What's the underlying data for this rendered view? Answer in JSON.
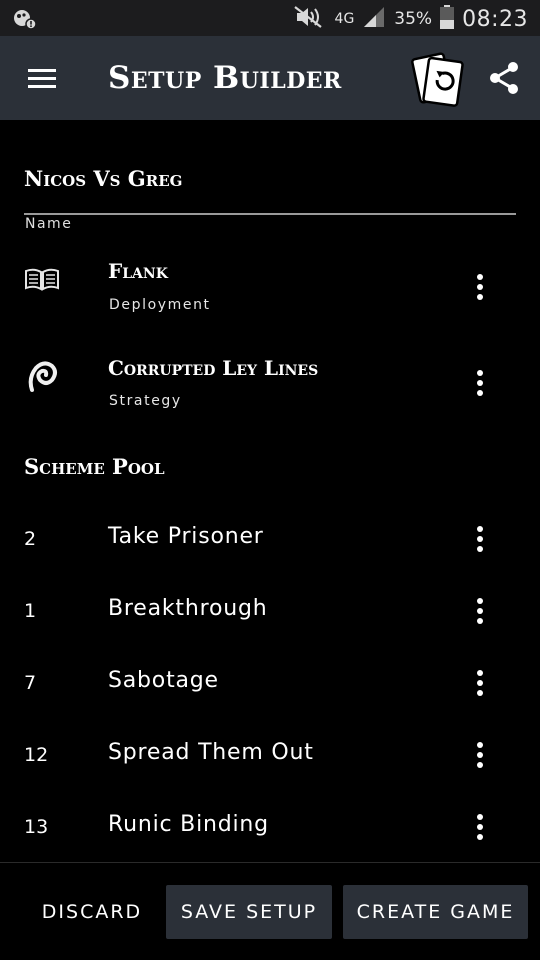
{
  "status_bar": {
    "network": "4G",
    "battery": "35%",
    "time": "08:23",
    "icons": [
      "notification-icon",
      "mute-icon",
      "signal-icon",
      "battery-icon"
    ]
  },
  "app_bar": {
    "title": "Setup Builder",
    "icons": [
      "menu-icon",
      "cards-undo-icon",
      "share-icon"
    ]
  },
  "setup": {
    "header": "Nicos Vs Greg",
    "name_label": "Name",
    "items": [
      {
        "title": "Flank",
        "subtitle": "Deployment",
        "icon": "book-icon"
      },
      {
        "title": "Corrupted Ley Lines",
        "subtitle": "Strategy",
        "icon": "swirl-icon"
      }
    ]
  },
  "scheme_pool": {
    "header": "Scheme Pool",
    "items": [
      {
        "number": "2",
        "name": "Take Prisoner"
      },
      {
        "number": "1",
        "name": "Breakthrough"
      },
      {
        "number": "7",
        "name": "Sabotage"
      },
      {
        "number": "12",
        "name": "Spread Them Out"
      },
      {
        "number": "13",
        "name": "Runic Binding"
      }
    ]
  },
  "actions": {
    "discard": "Discard",
    "save_setup": "Save Setup",
    "create_game": "Create Game"
  },
  "colors": {
    "background": "#000000",
    "app_bar": "#2b3038",
    "status_bar": "#1c1c1e",
    "text": "#ffffff"
  }
}
